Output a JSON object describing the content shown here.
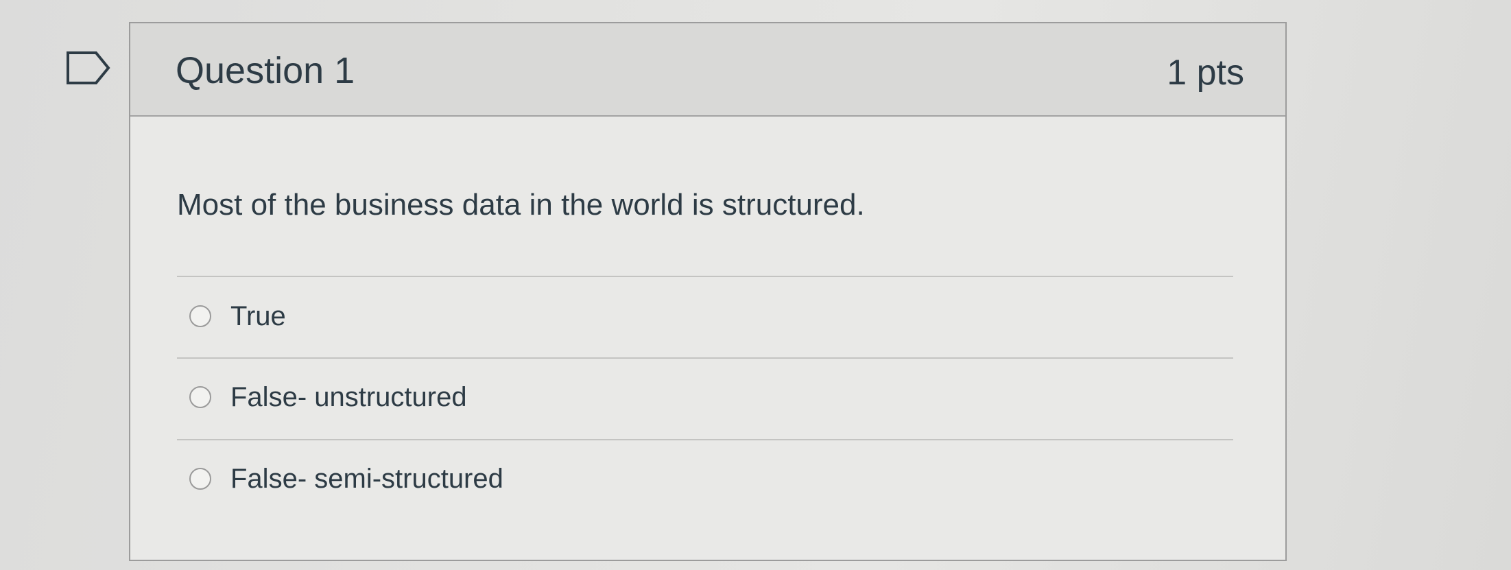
{
  "question": {
    "title": "Question 1",
    "points": "1 pts",
    "text": "Most of the business data in the world is structured.",
    "flag_icon": "bookmark-flag-icon",
    "answers": [
      {
        "label": "True",
        "selected": false
      },
      {
        "label": "False- unstructured",
        "selected": false
      },
      {
        "label": "False- semi-structured",
        "selected": false
      }
    ]
  },
  "colors": {
    "text": "#2d3b45",
    "header_bg": "#d9d9d7",
    "card_border": "#9c9c9c"
  }
}
